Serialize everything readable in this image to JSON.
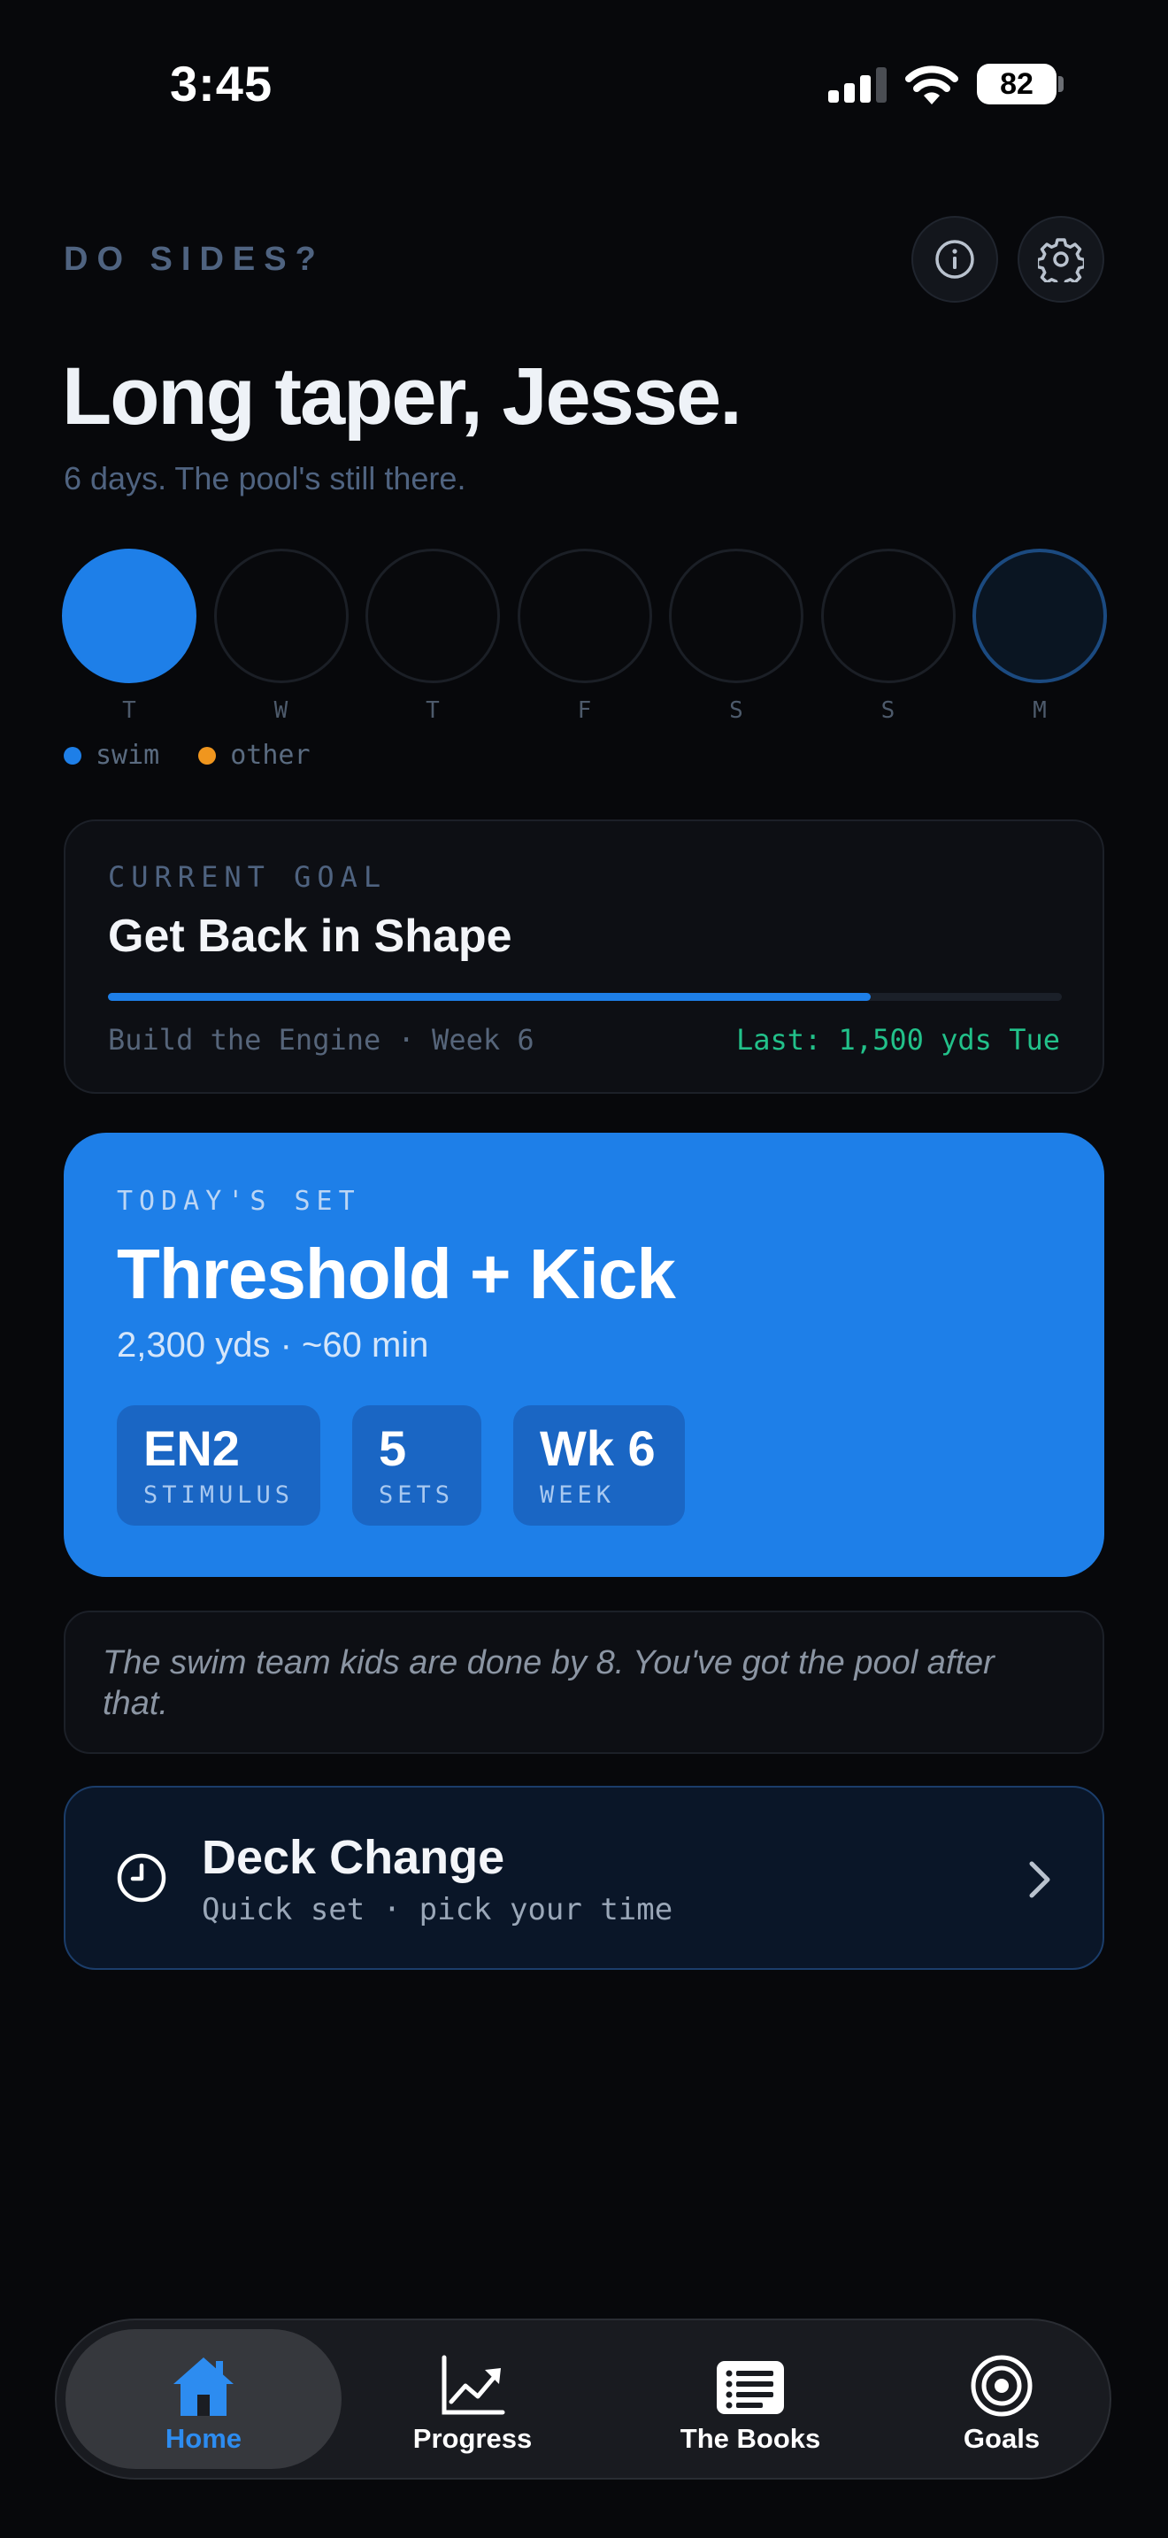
{
  "status_bar": {
    "time": "3:45",
    "battery": "82"
  },
  "header": {
    "app_title": "DO SIDES?",
    "greeting": "Long taper, Jesse.",
    "subtitle": "6 days. The pool's still there."
  },
  "week": {
    "days": [
      {
        "letter": "T",
        "state": "swim"
      },
      {
        "letter": "W",
        "state": "empty"
      },
      {
        "letter": "T",
        "state": "empty"
      },
      {
        "letter": "F",
        "state": "empty"
      },
      {
        "letter": "S",
        "state": "empty"
      },
      {
        "letter": "S",
        "state": "empty"
      },
      {
        "letter": "M",
        "state": "today"
      }
    ],
    "legend": [
      {
        "label": "swim",
        "color": "#1e7fe8"
      },
      {
        "label": "other",
        "color": "#f0961e"
      }
    ]
  },
  "goal": {
    "label": "CURRENT GOAL",
    "title": "Get Back in Shape",
    "progress": 0.8,
    "phase": "Build the Engine · Week 6",
    "last": "Last: 1,500 yds Tue"
  },
  "todays_set": {
    "label": "TODAY'S SET",
    "title": "Threshold + Kick",
    "meta": "2,300 yds · ~60 min",
    "chips": [
      {
        "value": "EN2",
        "label": "STIMULUS"
      },
      {
        "value": "5",
        "label": "SETS"
      },
      {
        "value": "Wk 6",
        "label": "WEEK"
      }
    ]
  },
  "quote": {
    "text": "The swim team kids are done by 8. You've got the pool after that."
  },
  "deck_change": {
    "title": "Deck Change",
    "subtitle": "Quick set · pick your time"
  },
  "tabs": [
    {
      "label": "Home",
      "icon": "home-icon",
      "active": true
    },
    {
      "label": "Progress",
      "icon": "chart-icon",
      "active": false
    },
    {
      "label": "The Books",
      "icon": "list-icon",
      "active": false
    },
    {
      "label": "Goals",
      "icon": "target-icon",
      "active": false
    }
  ],
  "colors": {
    "accent": "#1e7fe8",
    "success": "#22c18a",
    "background": "#07080b"
  }
}
